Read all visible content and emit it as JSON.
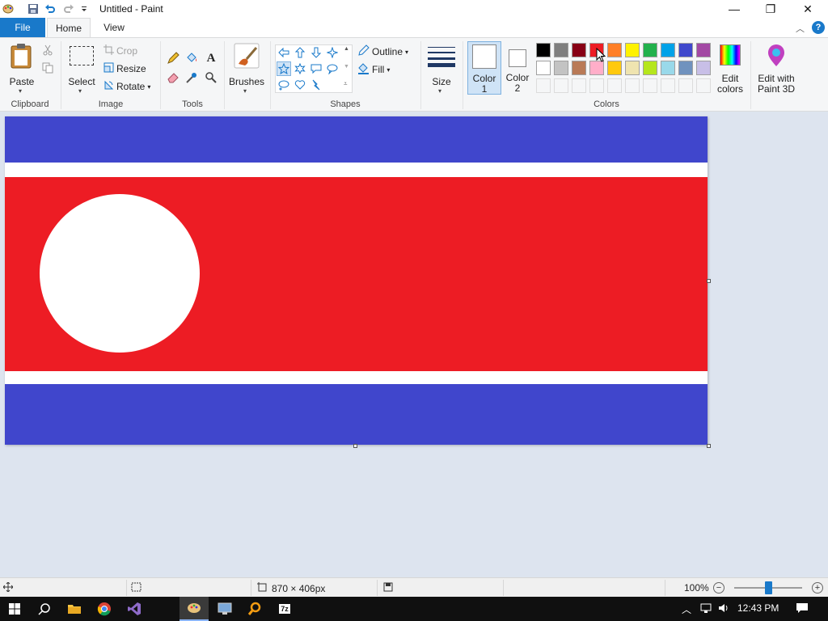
{
  "window": {
    "title": "Untitled - Paint"
  },
  "quick_access": [
    "paint-app-icon",
    "save-icon",
    "undo-icon",
    "redo-icon",
    "customize-qat-icon"
  ],
  "window_controls": {
    "minimize": "—",
    "restore": "❐",
    "close": "✕"
  },
  "tabs": {
    "file": "File",
    "home": "Home",
    "view": "View"
  },
  "ribbon": {
    "clipboard": {
      "label": "Clipboard",
      "paste": "Paste"
    },
    "image": {
      "label": "Image",
      "select": "Select",
      "crop": "Crop",
      "resize": "Resize",
      "rotate": "Rotate"
    },
    "tools": {
      "label": "Tools"
    },
    "brushes": {
      "label": "Brushes"
    },
    "shapes": {
      "label": "Shapes",
      "outline": "Outline",
      "fill": "Fill"
    },
    "size": {
      "label": "Size"
    },
    "colors": {
      "label": "Colors",
      "color1": "Color",
      "color1_num": "1",
      "color2": "Color",
      "color2_num": "2",
      "edit_colors_line1": "Edit",
      "edit_colors_line2": "colors",
      "edit_paint3d_line1": "Edit with",
      "edit_paint3d_line2": "Paint 3D",
      "row1": [
        "#000000",
        "#7f7f7f",
        "#880015",
        "#ed1c24",
        "#ff7f27",
        "#fff200",
        "#22b14c",
        "#00a2e8",
        "#3f48cc",
        "#a349a4"
      ],
      "row2": [
        "#ffffff",
        "#c3c3c3",
        "#b97a57",
        "#ffaec9",
        "#ffc90e",
        "#efe4b0",
        "#b5e61d",
        "#99d9ea",
        "#7092be",
        "#c8bfe7"
      ]
    }
  },
  "canvas": {
    "stripes": [
      {
        "name": "top-blue-stripe",
        "color": "#4046cc"
      },
      {
        "name": "top-white-stripe",
        "color": "#ffffff"
      },
      {
        "name": "center-red-field",
        "color": "#ed1c24"
      },
      {
        "name": "bottom-white-stripe",
        "color": "#ffffff"
      },
      {
        "name": "bottom-blue-stripe",
        "color": "#4046cc"
      }
    ],
    "disc_color": "#ffffff"
  },
  "statusbar": {
    "canvas_size": "870 × 406px",
    "zoom": "100%"
  },
  "taskbar": {
    "time": "12:43 PM"
  }
}
